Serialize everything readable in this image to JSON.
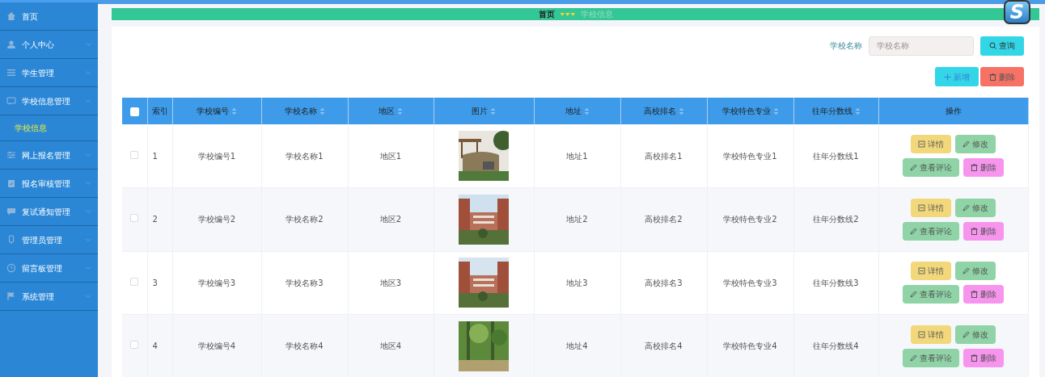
{
  "sidebar": {
    "items": [
      {
        "label": "首页",
        "kind": "link"
      },
      {
        "label": "个人中心",
        "kind": "group",
        "expanded": false
      },
      {
        "label": "学生管理",
        "kind": "group",
        "expanded": false
      },
      {
        "label": "学校信息管理",
        "kind": "group",
        "expanded": true,
        "children": [
          {
            "label": "学校信息",
            "selected": true
          }
        ]
      },
      {
        "label": "网上报名管理",
        "kind": "group",
        "expanded": false
      },
      {
        "label": "报名审核管理",
        "kind": "group",
        "expanded": false
      },
      {
        "label": "复试通知管理",
        "kind": "group",
        "expanded": false
      },
      {
        "label": "管理员管理",
        "kind": "group",
        "expanded": false
      },
      {
        "label": "留言板管理",
        "kind": "group",
        "expanded": false
      },
      {
        "label": "系统管理",
        "kind": "group",
        "expanded": false
      }
    ]
  },
  "logo": {
    "text": "S"
  },
  "breadcrumb": [
    {
      "label": "首页",
      "current": false
    },
    {
      "label": "学校信息",
      "current": true
    }
  ],
  "search": {
    "label": "学校名称",
    "placeholder": "学校名称",
    "button": "查询"
  },
  "toolbar": [
    {
      "label": "新增",
      "kind": "add"
    },
    {
      "label": "删除",
      "kind": "delete"
    }
  ],
  "table": {
    "select_all": {
      "checked": false
    },
    "columns": [
      {
        "label": "索引",
        "sortable": false
      },
      {
        "label": "学校编号",
        "sortable": true
      },
      {
        "label": "学校名称",
        "sortable": true
      },
      {
        "label": "地区",
        "sortable": true
      },
      {
        "label": "图片",
        "sortable": true
      },
      {
        "label": "地址",
        "sortable": true
      },
      {
        "label": "高校排名",
        "sortable": true
      },
      {
        "label": "学校特色专业",
        "sortable": true
      },
      {
        "label": "往年分数线",
        "sortable": true
      },
      {
        "label": "操作",
        "sortable": false
      }
    ],
    "rows": [
      {
        "checked": false,
        "cells": [
          "1",
          "学校编号1",
          "学校名称1",
          "地区1",
          {
            "kind": "picture"
          },
          "地址1",
          "高校排名1",
          "学校特色专业1",
          "往年分数线1"
        ],
        "actions": [
          {
            "label": "详情",
            "kind": "detail"
          },
          {
            "label": "修改",
            "kind": "edit"
          },
          {
            "label": "查看评论",
            "kind": "comments"
          },
          {
            "label": "删除",
            "kind": "delete"
          }
        ]
      },
      {
        "checked": false,
        "cells": [
          "2",
          "学校编号2",
          "学校名称2",
          "地区2",
          {
            "kind": "picture"
          },
          "地址2",
          "高校排名2",
          "学校特色专业2",
          "往年分数线2"
        ],
        "actions": [
          {
            "label": "详情",
            "kind": "detail"
          },
          {
            "label": "修改",
            "kind": "edit"
          },
          {
            "label": "查看评论",
            "kind": "comments"
          },
          {
            "label": "删除",
            "kind": "delete"
          }
        ]
      },
      {
        "checked": false,
        "cells": [
          "3",
          "学校编号3",
          "学校名称3",
          "地区3",
          {
            "kind": "picture"
          },
          "地址3",
          "高校排名3",
          "学校特色专业3",
          "往年分数线3"
        ],
        "actions": [
          {
            "label": "详情",
            "kind": "detail"
          },
          {
            "label": "修改",
            "kind": "edit"
          },
          {
            "label": "查看评论",
            "kind": "comments"
          },
          {
            "label": "删除",
            "kind": "delete"
          }
        ]
      },
      {
        "checked": false,
        "cells": [
          "4",
          "学校编号4",
          "学校名称4",
          "地区4",
          {
            "kind": "picture"
          },
          "地址4",
          "高校排名4",
          "学校特色专业4",
          "往年分数线4"
        ],
        "actions": [
          {
            "label": "详情",
            "kind": "detail"
          },
          {
            "label": "修改",
            "kind": "edit"
          },
          {
            "label": "查看评论",
            "kind": "comments"
          },
          {
            "label": "删除",
            "kind": "delete"
          }
        ]
      }
    ]
  }
}
